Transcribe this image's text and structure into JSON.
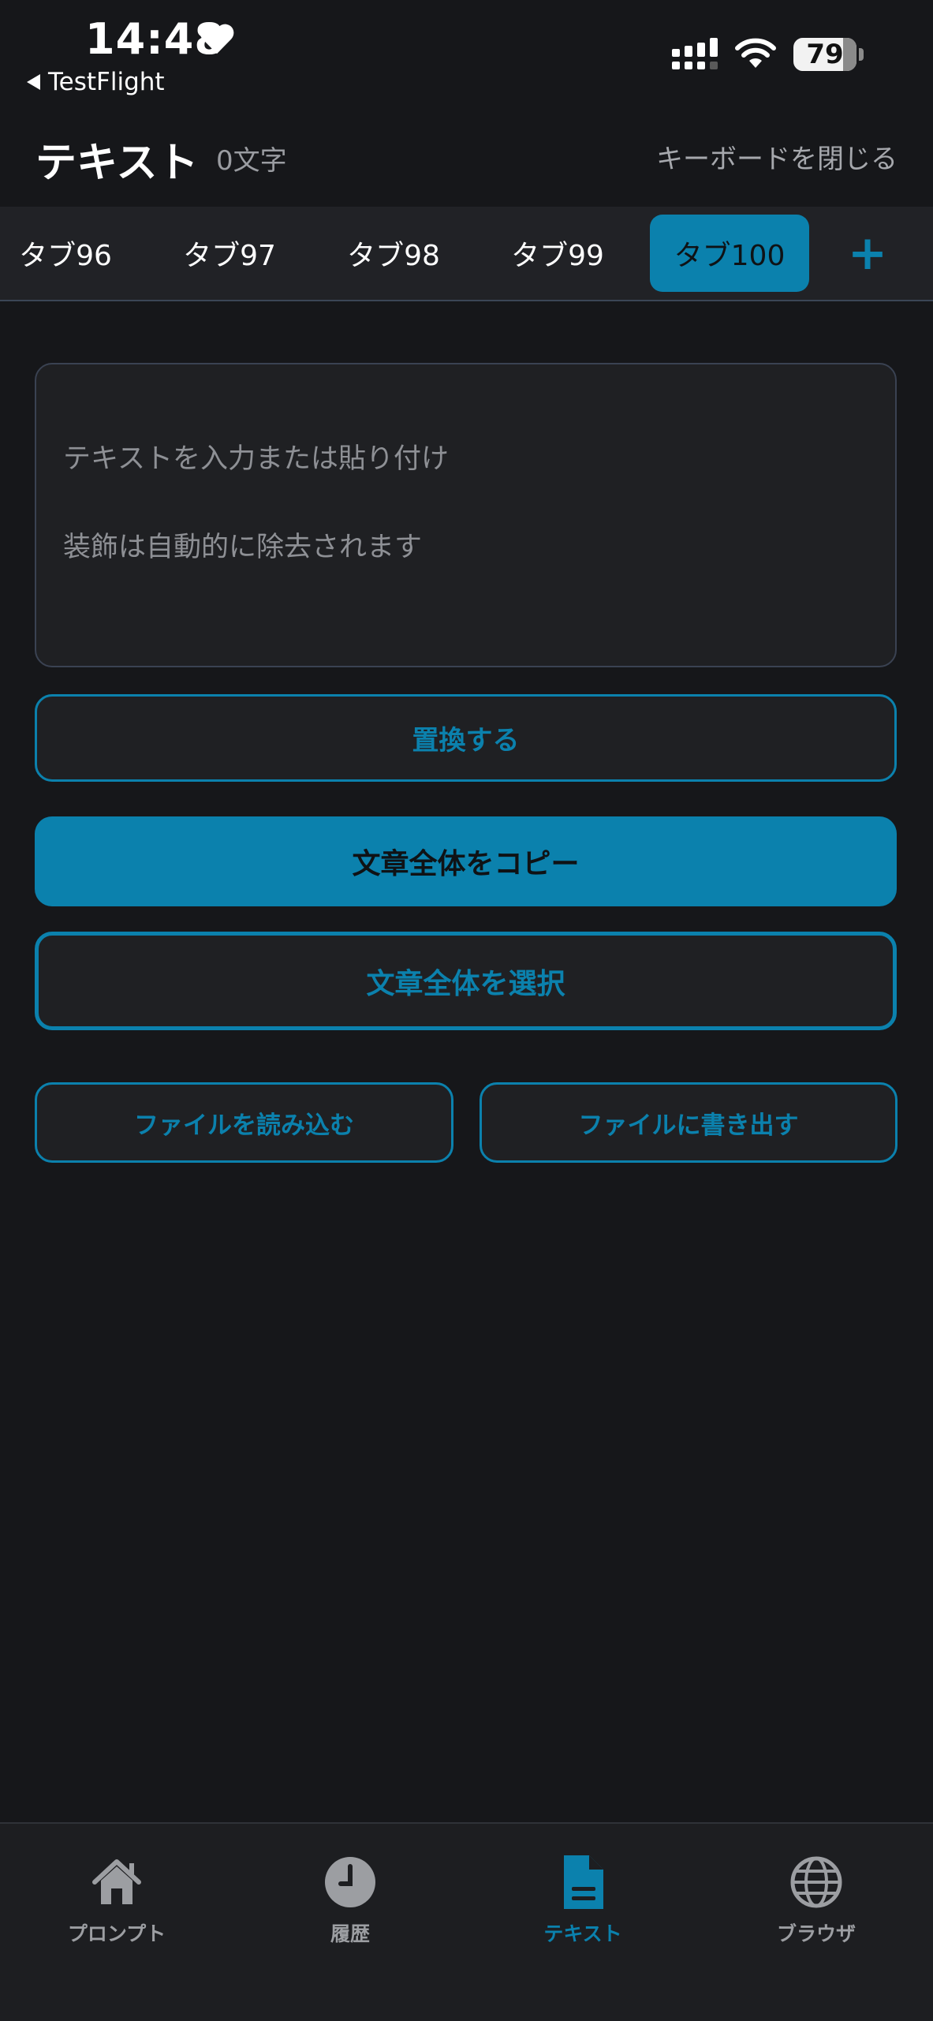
{
  "status_bar": {
    "time": "14:48",
    "back_app": "TestFlight",
    "battery": "79",
    "battery_level": 0.79
  },
  "header": {
    "title": "テキスト",
    "char_count": "0文字",
    "close_keyboard": "キーボードを閉じる"
  },
  "tabs": [
    {
      "label": "タブ96",
      "active": false
    },
    {
      "label": "タブ97",
      "active": false
    },
    {
      "label": "タブ98",
      "active": false
    },
    {
      "label": "タブ99",
      "active": false
    },
    {
      "label": "タブ100",
      "active": true
    }
  ],
  "add_tab_label": "+",
  "editor": {
    "value": "",
    "placeholder": "テキストを入力または貼り付け\n\n装飾は自動的に除去されます"
  },
  "buttons": {
    "replace": "置換する",
    "copy_all": "文章全体をコピー",
    "select_all": "文章全体を選択",
    "read_file": "ファイルを読み込む",
    "write_file": "ファイルに書き出す"
  },
  "bottom_nav": [
    {
      "label": "プロンプト",
      "icon": "home-icon",
      "active": false
    },
    {
      "label": "履歴",
      "icon": "clock-icon",
      "active": false
    },
    {
      "label": "テキスト",
      "icon": "document-icon",
      "active": true
    },
    {
      "label": "ブラウザ",
      "icon": "globe-icon",
      "active": false
    }
  ],
  "colors": {
    "accent": "#0b81ad",
    "background": "#16171a",
    "surface": "#1f2023"
  }
}
